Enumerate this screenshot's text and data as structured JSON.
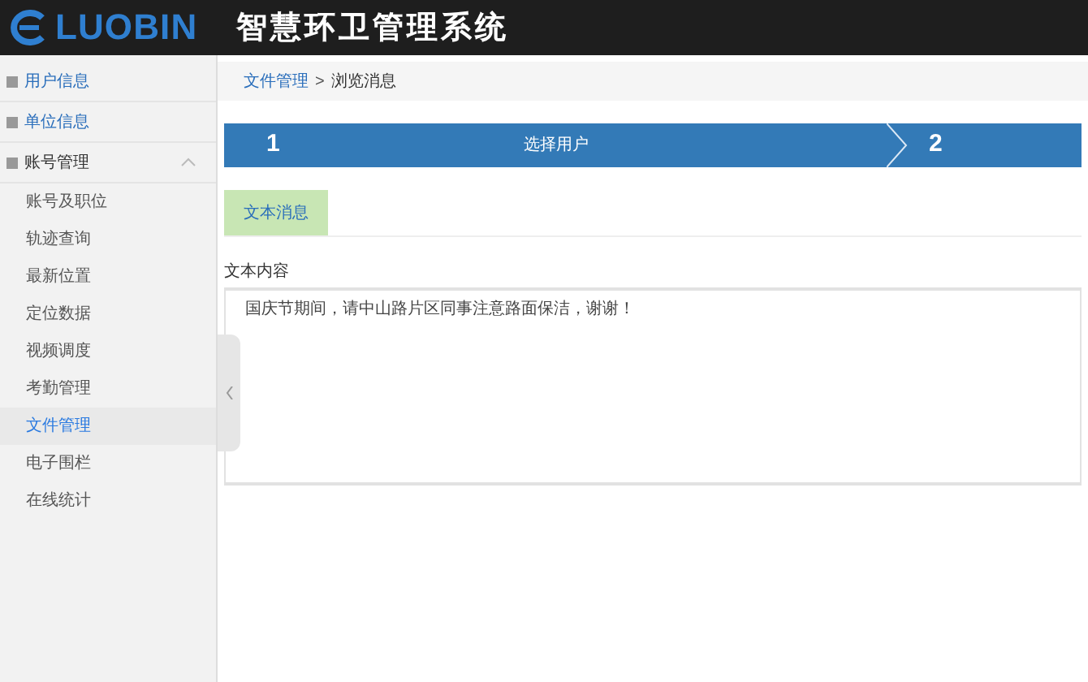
{
  "header": {
    "logo_text": "LUOBIN",
    "title": "智慧环卫管理系统"
  },
  "sidebar": {
    "items": [
      {
        "label": "用户信息",
        "expanded": false
      },
      {
        "label": "单位信息",
        "expanded": false
      },
      {
        "label": "账号管理",
        "expanded": true,
        "children": [
          {
            "label": "账号及职位",
            "selected": false
          },
          {
            "label": "轨迹查询",
            "selected": false
          },
          {
            "label": "最新位置",
            "selected": false
          },
          {
            "label": "定位数据",
            "selected": false
          },
          {
            "label": "视频调度",
            "selected": false
          },
          {
            "label": "考勤管理",
            "selected": false
          },
          {
            "label": "文件管理",
            "selected": true
          },
          {
            "label": "电子围栏",
            "selected": false
          },
          {
            "label": "在线统计",
            "selected": false
          }
        ]
      }
    ]
  },
  "breadcrumb": {
    "link": "文件管理",
    "separator": ">",
    "current": "浏览消息"
  },
  "steps": [
    {
      "number": "1",
      "label": "选择用户"
    },
    {
      "number": "2"
    }
  ],
  "tabs": [
    {
      "label": "文本消息",
      "selected": true
    }
  ],
  "form": {
    "label": "文本内容",
    "value": "国庆节期间，请中山路片区同事注意路面保洁，谢谢！"
  }
}
